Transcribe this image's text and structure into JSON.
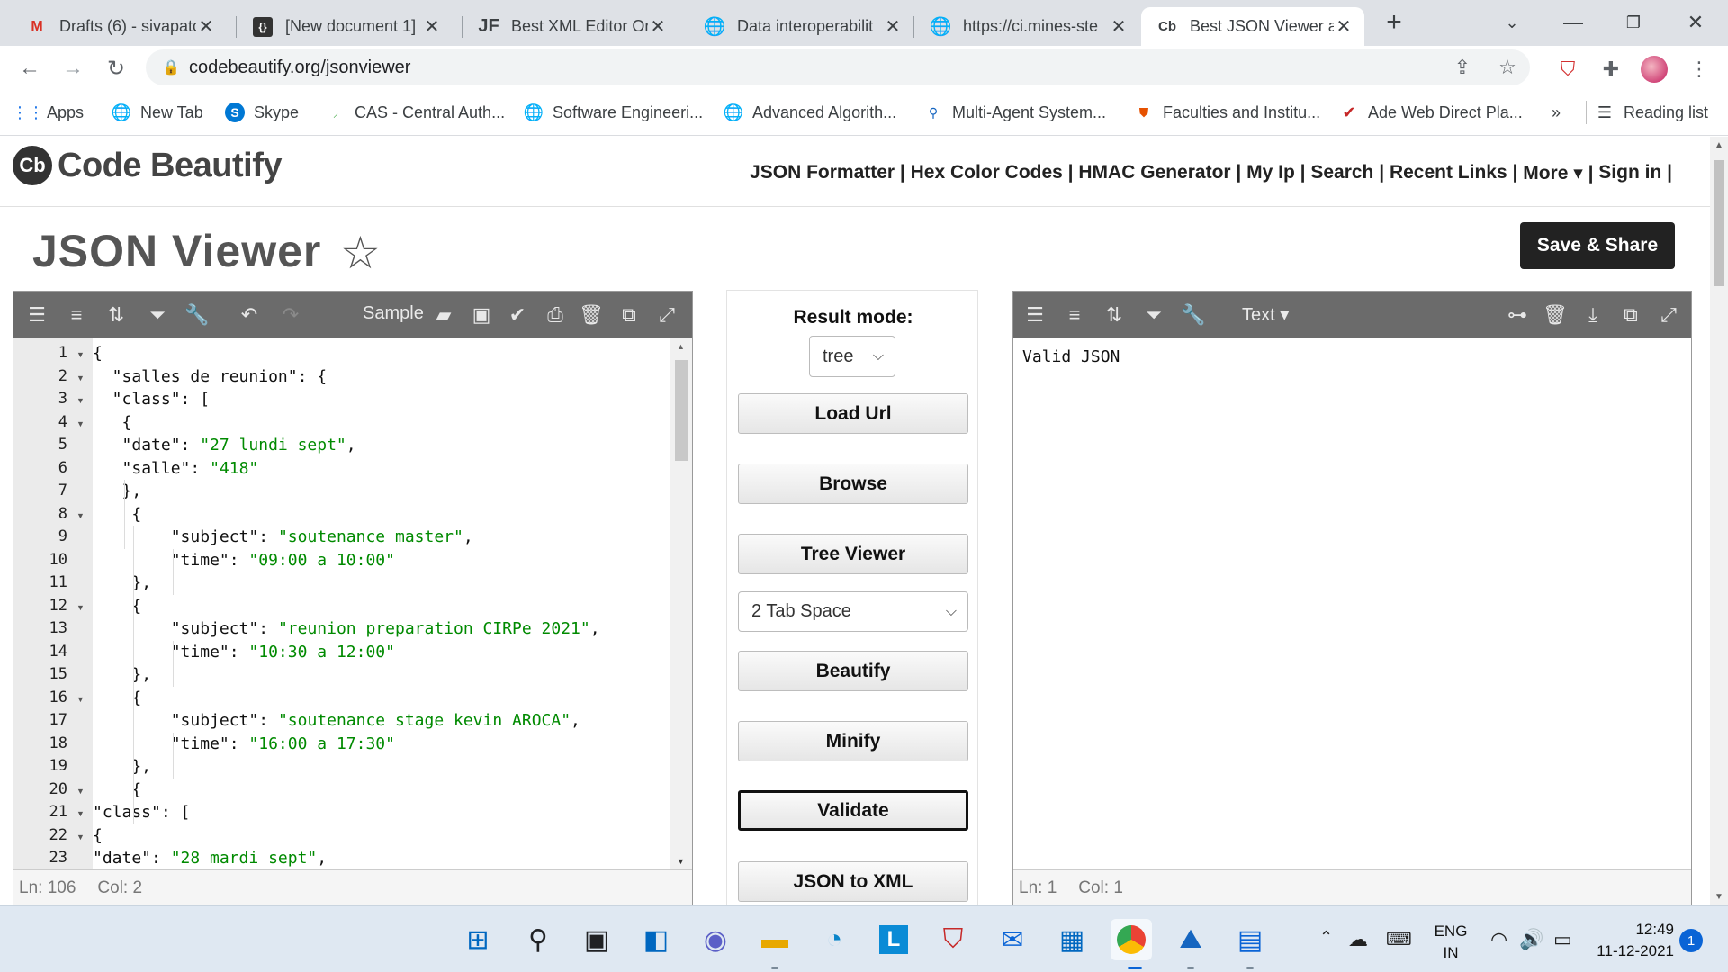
{
  "browser": {
    "tabs": [
      {
        "title": "Drafts (6) - sivapatc",
        "icon": "gmail-icon"
      },
      {
        "title": "[New document 1]",
        "icon": "braces-icon"
      },
      {
        "title": "Best XML Editor On",
        "icon": "jf-icon"
      },
      {
        "title": "Data interoperabilit",
        "icon": "globe-icon"
      },
      {
        "title": "https://ci.mines-ste",
        "icon": "globe-icon"
      },
      {
        "title": "Best JSON Viewer a",
        "icon": "cb-icon",
        "active": true
      }
    ],
    "new_tab_glyph": "+",
    "address": "codebeautify.org/jsonviewer",
    "bookmarks": [
      {
        "label": "Apps"
      },
      {
        "label": "New Tab"
      },
      {
        "label": "Skype"
      },
      {
        "label": "CAS - Central Auth..."
      },
      {
        "label": "Software Engineeri..."
      },
      {
        "label": "Advanced Algorith..."
      },
      {
        "label": "Multi-Agent System..."
      },
      {
        "label": "Faculties and Institu..."
      },
      {
        "label": "Ade Web Direct Pla..."
      }
    ],
    "bookmarks_overflow": "»",
    "reading_list": "Reading list"
  },
  "site": {
    "logo_text": "Code Beautify",
    "logo_mark": "Cb",
    "nav": [
      "JSON Formatter | ",
      "Hex Color Codes | ",
      "HMAC Generator | ",
      "My Ip | ",
      "Search | ",
      "Recent Links | ",
      "More ▾ | ",
      "Sign in |"
    ],
    "page_title": "JSON Viewer",
    "save_share": "Save & Share"
  },
  "left_panel": {
    "sample_label": "Sample",
    "status_ln": "Ln: 106",
    "status_col": "Col: 2",
    "lines": [
      {
        "n": "1",
        "fold": true,
        "indent": 0,
        "parts": [
          [
            "p",
            "{"
          ]
        ]
      },
      {
        "n": "2",
        "fold": true,
        "indent": 2,
        "parts": [
          [
            "p",
            "\"salles de reunion\": {"
          ]
        ]
      },
      {
        "n": "3",
        "fold": true,
        "indent": 2,
        "parts": [
          [
            "p",
            "\"class\": ["
          ]
        ]
      },
      {
        "n": "4",
        "fold": true,
        "indent": 3,
        "parts": [
          [
            "p",
            "{"
          ]
        ]
      },
      {
        "n": "5",
        "fold": false,
        "indent": 3,
        "parts": [
          [
            "p",
            "\"date\": "
          ],
          [
            "s",
            "\"27 lundi sept\""
          ],
          [
            "p",
            ","
          ]
        ]
      },
      {
        "n": "6",
        "fold": false,
        "indent": 3,
        "parts": [
          [
            "p",
            "\"salle\": "
          ],
          [
            "s",
            "\"418\""
          ]
        ]
      },
      {
        "n": "7",
        "fold": false,
        "indent": 3,
        "parts": [
          [
            "p",
            "},"
          ]
        ]
      },
      {
        "n": "8",
        "fold": true,
        "indent": 4,
        "parts": [
          [
            "p",
            "{"
          ]
        ]
      },
      {
        "n": "9",
        "fold": false,
        "indent": 8,
        "parts": [
          [
            "p",
            "\"subject\": "
          ],
          [
            "s",
            "\"soutenance master\""
          ],
          [
            "p",
            ","
          ]
        ]
      },
      {
        "n": "10",
        "fold": false,
        "indent": 8,
        "parts": [
          [
            "p",
            "\"time\": "
          ],
          [
            "s",
            "\"09:00 a 10:00\""
          ]
        ]
      },
      {
        "n": "11",
        "fold": false,
        "indent": 4,
        "parts": [
          [
            "p",
            "},"
          ]
        ]
      },
      {
        "n": "12",
        "fold": true,
        "indent": 4,
        "parts": [
          [
            "p",
            "{"
          ]
        ]
      },
      {
        "n": "13",
        "fold": false,
        "indent": 8,
        "parts": [
          [
            "p",
            "\"subject\": "
          ],
          [
            "s",
            "\"reunion preparation CIRPe 2021\""
          ],
          [
            "p",
            ","
          ]
        ]
      },
      {
        "n": "14",
        "fold": false,
        "indent": 8,
        "parts": [
          [
            "p",
            "\"time\": "
          ],
          [
            "s",
            "\"10:30 a 12:00\""
          ]
        ]
      },
      {
        "n": "15",
        "fold": false,
        "indent": 4,
        "parts": [
          [
            "p",
            "},"
          ]
        ]
      },
      {
        "n": "16",
        "fold": true,
        "indent": 4,
        "parts": [
          [
            "p",
            "{"
          ]
        ]
      },
      {
        "n": "17",
        "fold": false,
        "indent": 8,
        "parts": [
          [
            "p",
            "\"subject\": "
          ],
          [
            "s",
            "\"soutenance stage kevin AROCA\""
          ],
          [
            "p",
            ","
          ]
        ]
      },
      {
        "n": "18",
        "fold": false,
        "indent": 8,
        "parts": [
          [
            "p",
            "\"time\": "
          ],
          [
            "s",
            "\"16:00 a 17:30\""
          ]
        ]
      },
      {
        "n": "19",
        "fold": false,
        "indent": 4,
        "parts": [
          [
            "p",
            "},"
          ]
        ]
      },
      {
        "n": "20",
        "fold": true,
        "indent": 4,
        "parts": [
          [
            "p",
            "{"
          ]
        ]
      },
      {
        "n": "21",
        "fold": true,
        "indent": 0,
        "parts": [
          [
            "p",
            "\"class\": ["
          ]
        ]
      },
      {
        "n": "22",
        "fold": true,
        "indent": 0,
        "parts": [
          [
            "p",
            "{"
          ]
        ]
      },
      {
        "n": "23",
        "fold": false,
        "indent": 0,
        "parts": [
          [
            "p",
            "\"date\": "
          ],
          [
            "s",
            "\"28 mardi sept\""
          ],
          [
            "p",
            ","
          ]
        ]
      }
    ]
  },
  "middle": {
    "result_mode_label": "Result mode:",
    "result_mode_value": "tree",
    "buttons": [
      "Load Url",
      "Browse",
      "Tree Viewer"
    ],
    "tab_space_value": "2 Tab Space",
    "buttons2": [
      "Beautify",
      "Minify",
      "Validate",
      "JSON to XML"
    ]
  },
  "right_panel": {
    "mode_label": "Text ▾",
    "result": "Valid JSON",
    "status_ln": "Ln: 1",
    "status_col": "Col: 1"
  },
  "taskbar": {
    "lang_top": "ENG",
    "lang_bottom": "IN",
    "time": "12:49",
    "date": "11-12-2021",
    "notifications": "1"
  }
}
